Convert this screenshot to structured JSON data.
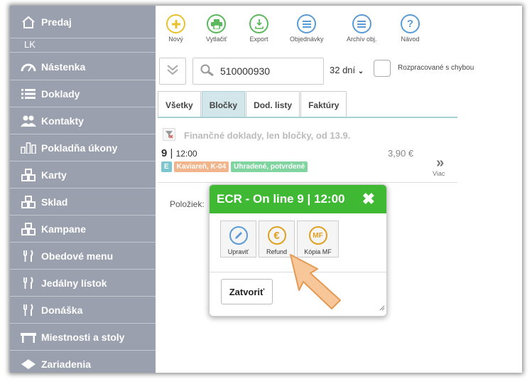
{
  "sidebar": {
    "section_title": "Predaj",
    "section_sub": "LK",
    "items": [
      {
        "label": "Nástenka",
        "icon": "gauge-icon"
      },
      {
        "label": "Doklady",
        "icon": "list-icon"
      },
      {
        "label": "Kontakty",
        "icon": "users-icon"
      },
      {
        "label": "Pokladňa úkony",
        "icon": "bar-chart-icon"
      },
      {
        "label": "Karty",
        "icon": "blocks-icon"
      },
      {
        "label": "Sklad",
        "icon": "blocks-icon"
      },
      {
        "label": "Kampane",
        "icon": "blocks-icon"
      },
      {
        "label": "Obedové menu",
        "icon": "cutlery-icon"
      },
      {
        "label": "Jedálny lístok",
        "icon": "cutlery-icon"
      },
      {
        "label": "Donáška",
        "icon": "cutlery-icon"
      },
      {
        "label": "Miestnosti a stoly",
        "icon": "table-icon"
      },
      {
        "label": "Zariadenia",
        "icon": "device-icon"
      }
    ]
  },
  "toolbar": {
    "buttons": [
      {
        "label": "Nový",
        "icon": "plus-icon",
        "color": "#e8c12e"
      },
      {
        "label": "Vytlačiť",
        "icon": "printer-icon",
        "color": "#5cb85c"
      },
      {
        "label": "Export",
        "icon": "download-icon",
        "color": "#5cb85c"
      },
      {
        "label": "Objednávky",
        "icon": "menu-icon",
        "color": "#5b9bd5"
      },
      {
        "label": "Archív obj.",
        "icon": "menu-icon",
        "color": "#5b9bd5"
      },
      {
        "label": "Návod",
        "icon": "question-icon",
        "color": "#5b9bd5"
      }
    ]
  },
  "filter": {
    "search_value": "510000930",
    "days": "32 dní",
    "checkbox_label": "Rozpracované s chybou"
  },
  "tabs": [
    {
      "label": "Všetky",
      "active": false
    },
    {
      "label": "Bločky",
      "active": true
    },
    {
      "label": "Dod. listy",
      "active": false
    },
    {
      "label": "Faktúry",
      "active": false
    }
  ],
  "list": {
    "title": "Finančné doklady, len bločky, od 13.9.",
    "record": {
      "number": "9",
      "separator": " | ",
      "time": "12:00",
      "amount": "3,90 €",
      "badges": [
        {
          "label": "E",
          "color": "#7cc6cf"
        },
        {
          "label": "Kaviareň, K-04",
          "color": "#f1b48b"
        },
        {
          "label": "Uhradené, potvrdené",
          "color": "#7fd4a0"
        }
      ],
      "more_label": "Viac",
      "more_glyph": "»"
    },
    "items_label": "Položiek:"
  },
  "modal": {
    "title": "ECR - On line 9 | 12:00",
    "close_glyph": "✖",
    "buttons": [
      {
        "label": "Upraviť",
        "icon": "pencil-icon",
        "color": "#5b9bd5"
      },
      {
        "label": "Refund",
        "icon": "euro-icon",
        "color": "#e0a020"
      },
      {
        "label": "Kópia MF",
        "icon": "mf-icon",
        "color": "#e0a020"
      }
    ],
    "close_label": "Zatvoriť"
  },
  "colors": {
    "sidebar_bg": "#9aa0ad",
    "modal_header": "#3fb834",
    "tab_active": "#d3e6ea",
    "pointer": "#f7c79a"
  }
}
